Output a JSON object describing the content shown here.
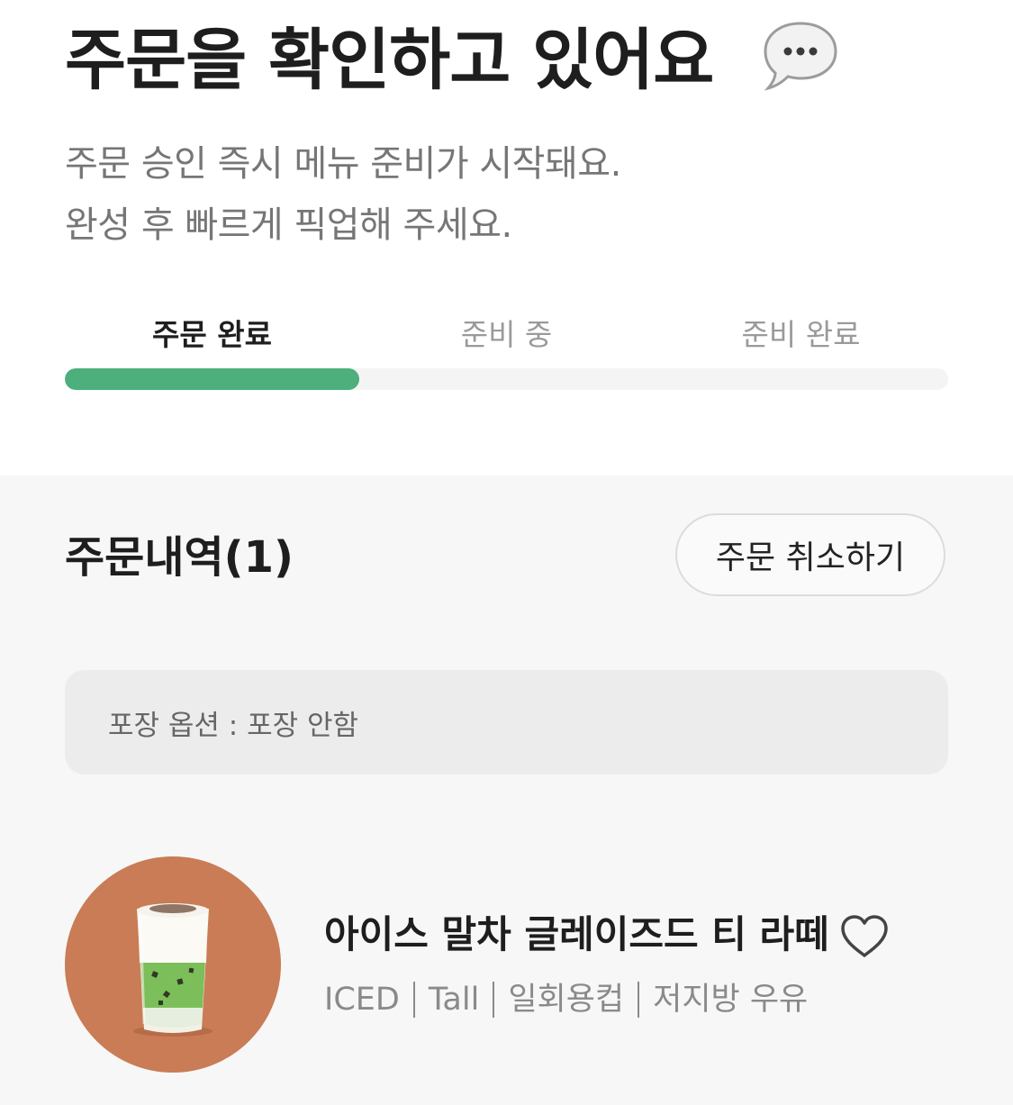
{
  "header": {
    "title": "주문을 확인하고 있어요",
    "title_icon": "speech-bubble-icon",
    "subtitle_lines": [
      "주문 승인 즉시 메뉴 준비가 시작돼요.",
      "완성 후 빠르게 픽업해 주세요."
    ]
  },
  "progress": {
    "steps": [
      {
        "label": "주문 완료",
        "active": true
      },
      {
        "label": "준비 중",
        "active": false
      },
      {
        "label": "준비 완료",
        "active": false
      }
    ],
    "current_step": 1,
    "total_steps": 3,
    "fill_color": "#4daf7c"
  },
  "order": {
    "section_title": "주문내역(1)",
    "cancel_label": "주문 취소하기",
    "packaging_text": "포장 옵션 : 포장 안함",
    "items": [
      {
        "name": "아이스 말차 글레이즈드 티 라떼",
        "options": [
          "ICED",
          "Tall",
          "일회용컵",
          "저지방 우유"
        ],
        "image_icon": "matcha-latte-image",
        "favorite_icon": "heart-outline-icon"
      }
    ]
  }
}
